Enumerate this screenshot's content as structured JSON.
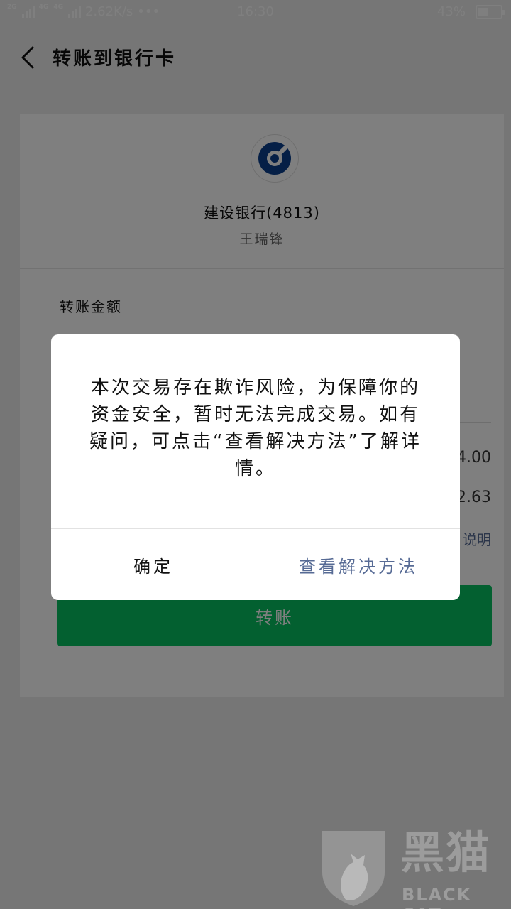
{
  "status_bar": {
    "sim1": "2G",
    "sim2": "4G",
    "sim3": "4G",
    "speed": "2.62K/s",
    "more": "•••",
    "time": "16:30",
    "battery_text": "43%",
    "battery_level": 0.43
  },
  "header": {
    "title": "转账到银行卡"
  },
  "payee": {
    "bank_name": "建设银行(4813)",
    "name": "王瑞锋"
  },
  "form": {
    "amount_label": "转账金额",
    "value_a": "4.00",
    "value_b": "2.63",
    "explain_link": "说明"
  },
  "transfer_button": {
    "label": "转账"
  },
  "dialog": {
    "message": "本次交易存在欺诈风险，为保障你的资金安全，暂时无法完成交易。如有疑问，可点击“查看解决方法”了解详情。",
    "confirm_label": "确定",
    "solution_label": "查看解决方法"
  },
  "watermark": {
    "brand_cn": "黑猫",
    "brand_en": "BLACK CAT"
  },
  "colors": {
    "accent_green": "#07c160",
    "link_blue": "#576b95",
    "bank_blue": "#0a3f8c"
  }
}
